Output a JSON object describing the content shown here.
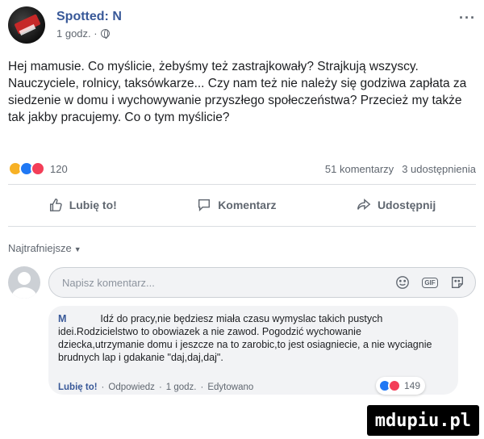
{
  "post": {
    "author": "Spotted: N",
    "time": "1 godz. ·",
    "more": "···",
    "text": "Hej mamusie. Co myślicie, żebyśmy też zastrajkowały? Strajkują wszyscy. Nauczyciele, rolnicy, taksówkarze... Czy nam też nie należy się godziwa zapłata za siedzenie w domu i wychowywanie przyszłego społeczeństwa? Przecież my także tak jakby pracujemy. Co o tym myślicie?"
  },
  "stats": {
    "reactions_count": "120",
    "comments": "51 komentarzy",
    "shares": "3 udostępnienia"
  },
  "actions": {
    "like": "Lubię to!",
    "comment": "Komentarz",
    "share": "Udostępnij"
  },
  "comments_section": {
    "sort_label": "Najtrafniejsze",
    "composer_placeholder": "Napisz komentarz..."
  },
  "comment": {
    "author": "M",
    "text": "Idź do pracy,nie będziesz miała czasu wymyslac takich pustych idei.Rodzicielstwo to obowiazek a nie zawod. Pogodzić wychowanie dziecka,utrzymanie domu i jeszcze na to zarobic,to jest osiagniecie, a nie wyciagnie brudnych lap i gdakanie \"daj,daj,daj\".",
    "like": "Lubię to!",
    "reply": "Odpowiedz",
    "time": "1 godz.",
    "edited": "Edytowano",
    "sep": "·",
    "reactions_count": "149"
  },
  "watermark": "mdupiu.pl",
  "colors": {
    "link": "#385898",
    "like_blue": "#2078f4",
    "love_red": "#f33e58",
    "haha_yellow": "#f7b125"
  }
}
